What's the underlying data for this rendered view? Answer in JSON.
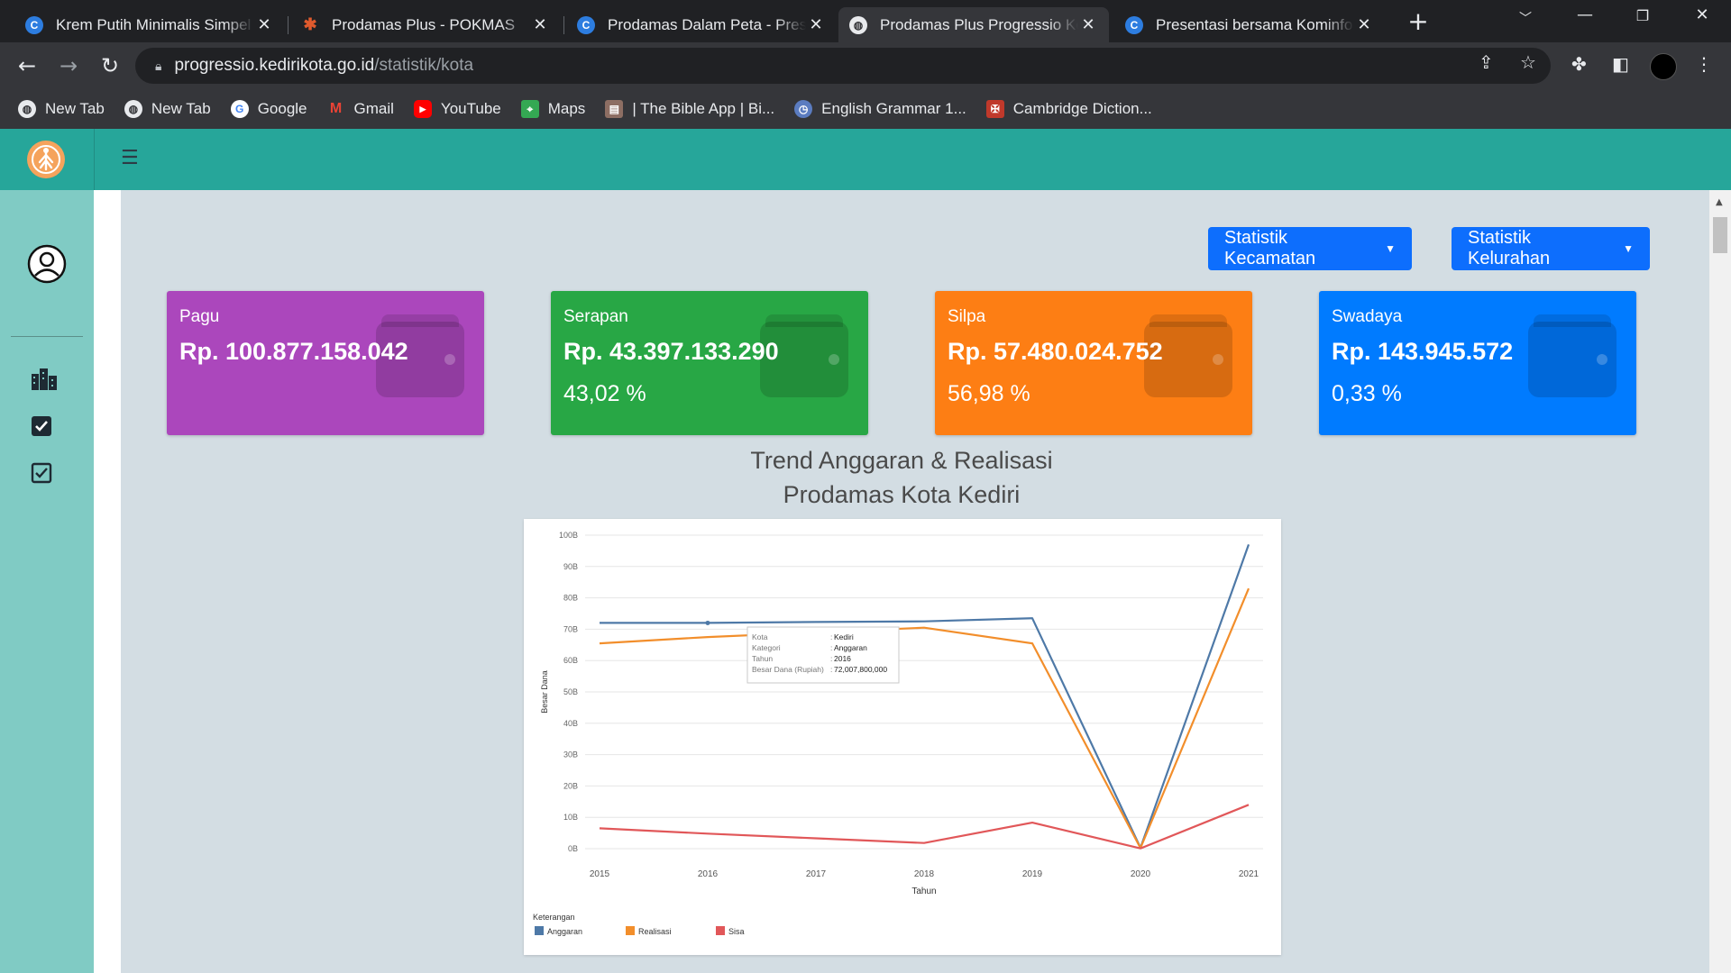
{
  "browser": {
    "tabs": [
      {
        "title": "Krem Putih Minimalis Simpel",
        "icon": "canva-icon",
        "color": "#2d7de0",
        "active": false
      },
      {
        "title": "Prodamas Plus - POKMAS",
        "icon": "prodamas-icon",
        "color": "#e05a2d",
        "active": false
      },
      {
        "title": "Prodamas Dalam Peta - Prese",
        "icon": "canva-icon",
        "color": "#2d7de0",
        "active": false
      },
      {
        "title": "Prodamas Plus Progressio Ko",
        "icon": "globe-icon",
        "color": "#5f6368",
        "active": true
      },
      {
        "title": "Presentasi bersama Kominfo",
        "icon": "canva-icon",
        "color": "#2d7de0",
        "active": false
      }
    ],
    "url_host": "progressio.kedirikota.go.id",
    "url_path": "/statistik/kota",
    "bookmarks": [
      {
        "label": "New Tab",
        "icon": "globe-icon",
        "color": "#e8eaed"
      },
      {
        "label": "New Tab",
        "icon": "globe-icon",
        "color": "#e8eaed"
      },
      {
        "label": "Google",
        "icon": "google-icon",
        "color": "#ffffff"
      },
      {
        "label": "Gmail",
        "icon": "gmail-icon",
        "color": "#ea4335"
      },
      {
        "label": "YouTube",
        "icon": "youtube-icon",
        "color": "#ff0000"
      },
      {
        "label": "Maps",
        "icon": "maps-icon",
        "color": "#34a853"
      },
      {
        "label": "| The Bible App | Bi...",
        "icon": "bible-icon",
        "color": "#8d6e63"
      },
      {
        "label": "English Grammar 1...",
        "icon": "grammar-icon",
        "color": "#5b7cc0"
      },
      {
        "label": "Cambridge Diction...",
        "icon": "cambridge-icon",
        "color": "#c0392b"
      }
    ]
  },
  "toolbar": {
    "dropdown_kecamatan": "Statistik Kecamatan",
    "dropdown_kelurahan": "Statistik Kelurahan"
  },
  "cards": [
    {
      "label": "Pagu",
      "amount": "Rp. 100.877.158.042",
      "percent": "",
      "color": "#ab47bc"
    },
    {
      "label": "Serapan",
      "amount": "Rp. 43.397.133.290",
      "percent": "43,02 %",
      "color": "#28a745"
    },
    {
      "label": "Silpa",
      "amount": "Rp. 57.480.024.752",
      "percent": "56,98 %",
      "color": "#fd7e14"
    },
    {
      "label": "Swadaya",
      "amount": "Rp. 143.945.572",
      "percent": "0,33 %",
      "color": "#007bff"
    }
  ],
  "chart_title_1": "Trend Anggaran & Realisasi",
  "chart_title_2": "Prodamas Kota Kediri",
  "chart_data": {
    "type": "line",
    "x": [
      2015,
      2016,
      2017,
      2018,
      2019,
      2020,
      2021
    ],
    "x_tick_labels": [
      "2015",
      "2016",
      "2017",
      "2018",
      "2019",
      "2020",
      "2021"
    ],
    "xlabel": "Tahun",
    "ylabel": "Besar Dana",
    "ylim": [
      0,
      100
    ],
    "y_unit": "B",
    "y_tick_labels": [
      "0B",
      "10B",
      "20B",
      "30B",
      "40B",
      "50B",
      "60B",
      "70B",
      "80B",
      "90B",
      "100B"
    ],
    "grid": true,
    "legend_title": "Keterangan",
    "legend_position": "bottom-left",
    "series": [
      {
        "name": "Anggaran",
        "color": "#4e79a7",
        "values": [
          72.0,
          72.0,
          72.3,
          72.5,
          73.5,
          0.3,
          97.0
        ]
      },
      {
        "name": "Realisasi",
        "color": "#f28e2b",
        "values": [
          65.5,
          67.5,
          69.0,
          70.5,
          65.5,
          0.2,
          83.0
        ]
      },
      {
        "name": "Sisa",
        "color": "#e15759",
        "values": [
          6.5,
          4.8,
          3.3,
          1.8,
          8.3,
          0.1,
          14.0
        ]
      }
    ],
    "tooltip": {
      "rows": [
        {
          "key": "Kota",
          "value": "Kediri"
        },
        {
          "key": "Kategori",
          "value": "Anggaran"
        },
        {
          "key": "Tahun",
          "value": "2016"
        },
        {
          "key": "Besar Dana (Rupiah)",
          "value": "72,007,800,000"
        }
      ]
    }
  }
}
